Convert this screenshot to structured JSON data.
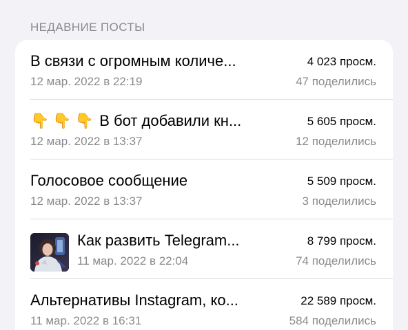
{
  "section_header": "НЕДАВНИЕ ПОСТЫ",
  "posts": [
    {
      "title": "В связи с огромным количе...",
      "date": "12 мар. 2022 в 22:19",
      "views": "4 023 просм.",
      "shares": "47 поделились"
    },
    {
      "prefix_emoji": [
        "👇",
        "👇",
        "👇"
      ],
      "title": "В бот добавили кн...",
      "date": "12 мар. 2022 в 13:37",
      "views": "5 605 просм.",
      "shares": "12 поделились"
    },
    {
      "title": "Голосовое сообщение",
      "date": "12 мар. 2022 в 13:37",
      "views": "5 509 просм.",
      "shares": "3 поделились"
    },
    {
      "thumbnail": "photo-thumbnail",
      "title": "Как развить Telegram...",
      "date": "11 мар. 2022 в 22:04",
      "views": "8 799 просм.",
      "shares": "74 поделились"
    },
    {
      "title": "Альтернативы Instagram, ко...",
      "date": "11 мар. 2022 в 16:31",
      "views": "22 589 просм.",
      "shares": "584 поделились"
    }
  ]
}
